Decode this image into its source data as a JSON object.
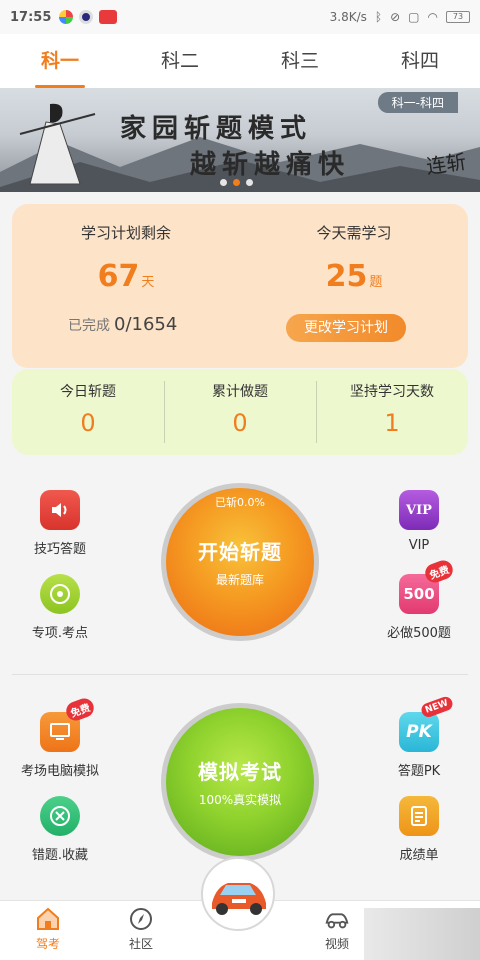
{
  "status": {
    "time": "17:55",
    "network": "3.8K/s",
    "battery": "73"
  },
  "tabs": [
    "科一",
    "科二",
    "科三",
    "科四"
  ],
  "banner": {
    "line1": "家园斩题模式",
    "line2": "越斩越痛快",
    "tag": "科一-科四",
    "brush": "连斩"
  },
  "plan": {
    "remaining_label": "学习计划剩余",
    "remaining_value": "67",
    "remaining_unit": "天",
    "today_label": "今天需学习",
    "today_value": "25",
    "today_unit": "题",
    "done_label": "已完成",
    "done_value": "0/1654",
    "change_button": "更改学习计划"
  },
  "stats": [
    {
      "label": "今日斩题",
      "value": "0"
    },
    {
      "label": "累计做题",
      "value": "0"
    },
    {
      "label": "坚持学习天数",
      "value": "1"
    }
  ],
  "actions": {
    "tips": "技巧答题",
    "topic": "专项.考点",
    "vip": "VIP",
    "vip_icon_text": "VIP",
    "must500": "必做500题",
    "must500_icon_text": "500",
    "computer": "考场电脑模拟",
    "wrong": "错题.收藏",
    "pk": "答题PK",
    "pk_icon_text": "PK",
    "report": "成绩单",
    "badge_free": "免费",
    "badge_new": "NEW"
  },
  "start": {
    "progress": "已斩0.0%",
    "title": "开始斩题",
    "sub": "最新题库"
  },
  "exam": {
    "title": "模拟考试",
    "sub": "100%真实模拟"
  },
  "nav": {
    "drive": "驾考",
    "community": "社区",
    "video": "视频"
  },
  "colors": {
    "accent": "#f07e1e"
  }
}
